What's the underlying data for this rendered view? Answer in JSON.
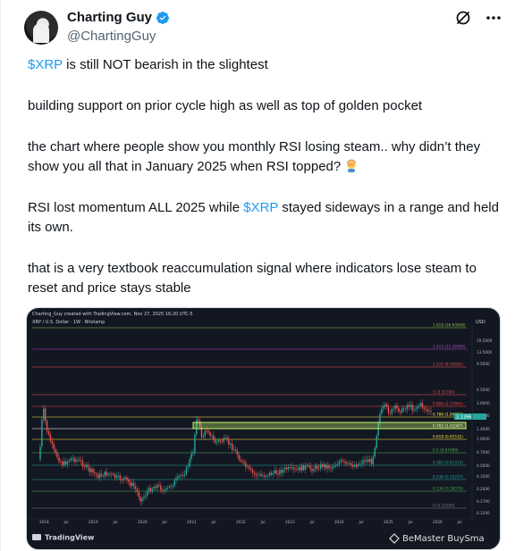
{
  "author": {
    "display_name": "Charting Guy",
    "handle": "@ChartingGuy"
  },
  "icons": [
    "avatar-image",
    "verified-badge-icon",
    "grok-icon",
    "more-icon",
    "woman-facepalming-emoji",
    "tradingview-logo-icon",
    "bemaster-logo-icon"
  ],
  "tweet": {
    "cashtag": "$XRP",
    "p1_rest": " is still NOT bearish in the slightest",
    "p2": "building support on prior cycle high as well as top of golden pocket",
    "p3": "the chart where people show you monthly RSI losing steam.. why didn’t they show you all that in January 2025 when RSI topped?",
    "p4_a": "RSI lost momentum ALL 2025 while ",
    "p4_b": " stayed sideways in a range and held its own.",
    "p5": "that is a very textbook reaccumulation signal where indicators lose steam to reset and price stays stable"
  },
  "chart_image": {
    "header": "Charting_Guy created with TradingView.com, Nov 27, 2025 16:20 UTC-5",
    "symbol_line": "XRP / U.S. Dollar · 1W · Bitstamp",
    "currency": "USD",
    "branding": "TradingView",
    "watermark": "BeMaster BuySma",
    "x_labels": [
      "2018",
      "Jul",
      "2019",
      "Jul",
      "2020",
      "Jul",
      "2021",
      "Jul",
      "2022",
      "Jul",
      "2023",
      "Jul",
      "2024",
      "Jul",
      "2025",
      "Jul",
      "2026",
      "Jul"
    ],
    "y_labels": [
      "19.5000",
      "13.5000",
      "9.5000",
      "4.5000",
      "3.0000",
      "2.0000",
      "1.4000",
      "1.0000",
      "0.7000",
      "0.5000",
      "0.3500",
      "0.2400",
      "0.1700",
      "0.1200"
    ],
    "fib_levels": [
      {
        "label": "1.618 (26.63058)",
        "color": "#8bc34a"
      },
      {
        "label": "1.414 (13.28960)",
        "color": "#ab47bc"
      },
      {
        "label": "1.272 (9.79591)",
        "color": "#ef5350"
      },
      {
        "label": "1 (3.31700)",
        "color": "#ef5350"
      },
      {
        "label": "0.886 (2.37665)",
        "color": "#f44336"
      },
      {
        "label": "0.786 (1.84774)",
        "color": "#ffeb3b"
      },
      {
        "label": "0.702 (1.41067)",
        "color": "#ffffff"
      },
      {
        "label": "0.618 (0.91531)",
        "color": "#ffeb3b"
      },
      {
        "label": "0.5 (0.67489)",
        "color": "#4caf50"
      },
      {
        "label": "0.382 (0.41315)",
        "color": "#26a69a"
      },
      {
        "label": "0.236 (0.25257)",
        "color": "#26a69a"
      },
      {
        "label": "0.136 (0.18070)",
        "color": "#4caf50"
      },
      {
        "label": "0 (0.11659)",
        "color": "#787b86"
      }
    ],
    "price_tag": "2.1396"
  },
  "colors": {
    "link": "#1d9bf0",
    "verified": "#1d9bf0",
    "chart_bg": "#131722",
    "candle_up": "#26a69a",
    "candle_down": "#ef5350",
    "support_box": "#c6f46b"
  }
}
